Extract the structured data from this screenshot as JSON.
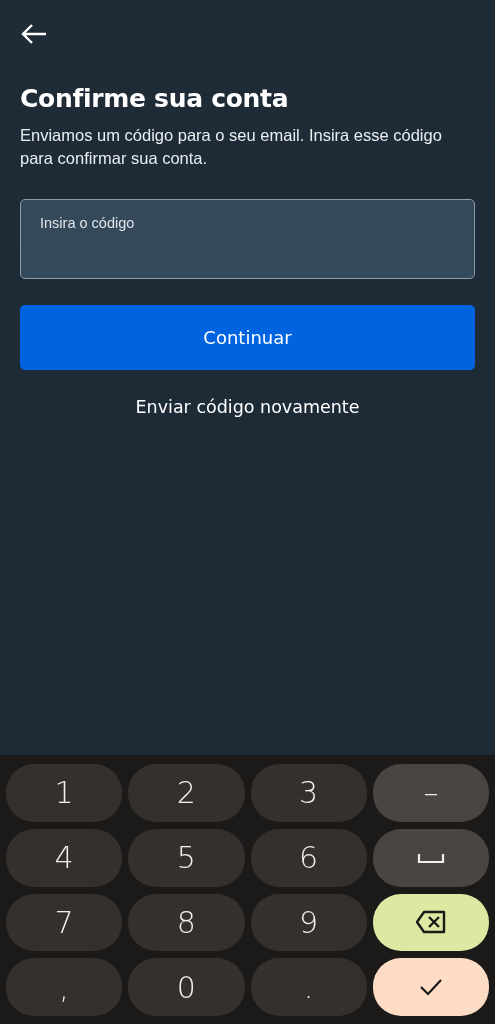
{
  "header": {
    "title": "Confirme sua conta",
    "description": "Enviamos um código para o seu email. Insira esse código para confirmar sua conta."
  },
  "code_field": {
    "placeholder": "Insira o código"
  },
  "continue_button": {
    "label": "Continuar"
  },
  "resend_link": {
    "label": "Enviar código novamente"
  },
  "keyboard": {
    "keys": [
      {
        "kind": "char",
        "label": "1"
      },
      {
        "kind": "char",
        "label": "2"
      },
      {
        "kind": "char",
        "label": "3"
      },
      {
        "kind": "symbol",
        "label": "–"
      },
      {
        "kind": "char",
        "label": "4"
      },
      {
        "kind": "char",
        "label": "5"
      },
      {
        "kind": "char",
        "label": "6"
      },
      {
        "kind": "space"
      },
      {
        "kind": "char",
        "label": "7"
      },
      {
        "kind": "char",
        "label": "8"
      },
      {
        "kind": "char",
        "label": "9"
      },
      {
        "kind": "backspace"
      },
      {
        "kind": "char",
        "label": ","
      },
      {
        "kind": "char",
        "label": "0"
      },
      {
        "kind": "char",
        "label": "."
      },
      {
        "kind": "enter"
      }
    ]
  }
}
